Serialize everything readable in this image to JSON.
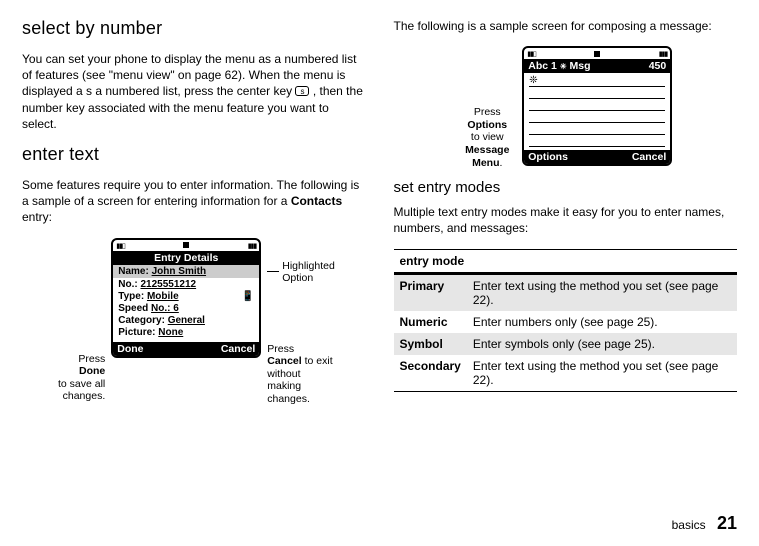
{
  "left": {
    "h2": "select by number",
    "p1a": "You can set your phone to display the menu as a numbered list of features (see \"menu view\" on page 62). When the menu is displayed a s a numbered list, press the center key ",
    "keyglyph": "s",
    "p1b": ", then the number key associated with the menu feature you want to select.",
    "h2b": "enter text",
    "p2a": "Some features require you to enter information. The following is a sample of a screen for entering information for a ",
    "p2bold": "Contacts",
    "p2b": " entry:",
    "phone1": {
      "title": "Entry Details",
      "fields": {
        "nameLab": "Name:",
        "nameVal": "John Smith",
        "noLab": "No.:",
        "noVal": "2125551212",
        "typeLab": "Type:",
        "typeVal": "Mobile",
        "speedLab": "Speed",
        "speedVal": "No.: 6",
        "catLab": "Category:",
        "catVal": "General",
        "picLab": "Picture:",
        "picVal": "None"
      },
      "skLeft": "Done",
      "skRight": "Cancel"
    },
    "callouts": {
      "left1": "Press",
      "leftBold": "Done",
      "left2": "to save all changes.",
      "rightTop1": "Highlighted Option",
      "right1": "Press",
      "rightBold": "Cancel",
      "right2": " to exit without making changes."
    }
  },
  "right": {
    "introA": "The following is a sample screen for composing a message:",
    "phone2": {
      "abc": "Abc 1",
      "msg": "Msg",
      "count": "450",
      "snow": "❊",
      "skLeft": "Options",
      "skRight": "Cancel"
    },
    "callout2": {
      "a": "Press",
      "b": "Options",
      "c": "to view",
      "d": "Message Menu",
      "e": "."
    },
    "h3": "set entry modes",
    "p3": "Multiple text entry modes make it easy for you to enter names, numbers, and messages:",
    "table": {
      "head": "entry mode",
      "rows": {
        "r1m": "Primary",
        "r1t": "Enter text using the method you set (see page 22).",
        "r2m": "Numeric",
        "r2t": "Enter numbers only (see page 25).",
        "r3m": "Symbol",
        "r3t": "Enter symbols only (see page 25).",
        "r4m": "Secondary",
        "r4t": "Enter text using the method you set (see page 22)."
      }
    }
  },
  "footer": {
    "section": "basics",
    "page": "21"
  }
}
